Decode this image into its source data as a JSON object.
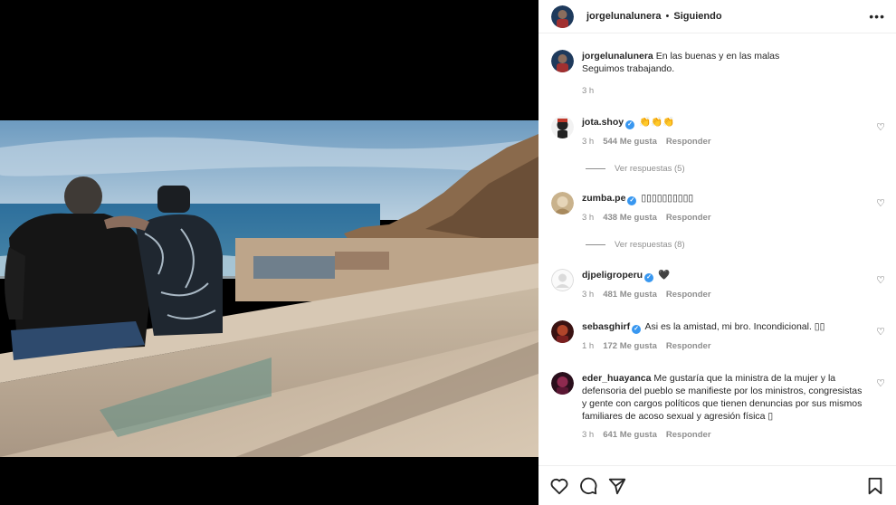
{
  "post": {
    "username": "jorgelunalunera",
    "separator": "•",
    "follow_status": "Siguiendo",
    "more_label": "•••",
    "caption_line1": "En las buenas y en las malas",
    "caption_line2": "Seguimos trabajando.",
    "caption_time": "3 h"
  },
  "comments": [
    {
      "username": "jota.shoy",
      "verified": true,
      "text": "👏👏👏",
      "time": "3 h",
      "likes": "544 Me gusta",
      "reply": "Responder"
    },
    {
      "username": "zumba.pe",
      "verified": true,
      "text": "▯▯▯▯▯▯▯▯▯▯",
      "time": "3 h",
      "likes": "438 Me gusta",
      "reply": "Responder"
    },
    {
      "username": "djpeligroperu",
      "verified": true,
      "text": "🖤",
      "time": "3 h",
      "likes": "481 Me gusta",
      "reply": "Responder"
    },
    {
      "username": "sebasghirf",
      "verified": true,
      "text": "Asi es la amistad, mi bro. Incondicional. ▯▯",
      "time": "1 h",
      "likes": "172 Me gusta",
      "reply": "Responder"
    },
    {
      "username": "eder_huayanca",
      "verified": false,
      "text": "Me gustaría que la ministra de la mujer y la defensoria del pueblo se manifieste por los ministros, congresistas y gente con cargos políticos que tienen denuncias por sus mismos familiares de acoso sexual y agresión física ▯",
      "time": "3 h",
      "likes": "641 Me gusta",
      "reply": "Responder"
    }
  ],
  "replies": [
    {
      "label": "Ver respuestas (5)"
    },
    {
      "label": "Ver respuestas (8)"
    }
  ],
  "icons": {
    "like": "heart-icon",
    "comment": "comment-icon",
    "share": "share-icon",
    "save": "bookmark-icon",
    "comment_like": "♡"
  },
  "colors": {
    "verified": "#3897f0",
    "muted": "#8e8e8e",
    "text": "#262626"
  }
}
